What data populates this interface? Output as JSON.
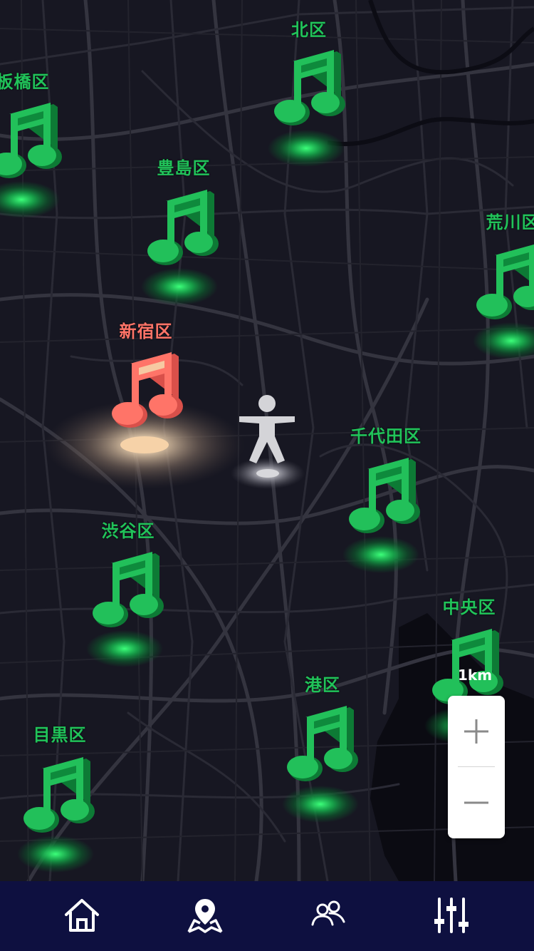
{
  "map": {
    "scale_label": "1km",
    "user_marker_icon": "person-icon",
    "districts": [
      {
        "id": "kita",
        "label": "北区",
        "icon": "music-note-icon",
        "color": "#21c35a",
        "active": false
      },
      {
        "id": "itabashi",
        "label": "板橋区",
        "icon": "music-note-icon",
        "color": "#21c35a",
        "active": false
      },
      {
        "id": "toshima",
        "label": "豊島区",
        "icon": "music-note-icon",
        "color": "#21c35a",
        "active": false
      },
      {
        "id": "arakawa",
        "label": "荒川区",
        "icon": "music-note-icon",
        "color": "#21c35a",
        "active": false
      },
      {
        "id": "shinjuku",
        "label": "新宿区",
        "icon": "music-note-icon",
        "color": "#ff7468",
        "active": true
      },
      {
        "id": "chiyoda",
        "label": "千代田区",
        "icon": "music-note-icon",
        "color": "#21c35a",
        "active": false
      },
      {
        "id": "shibuya",
        "label": "渋谷区",
        "icon": "music-note-icon",
        "color": "#21c35a",
        "active": false
      },
      {
        "id": "chuo",
        "label": "中央区",
        "icon": "music-note-icon",
        "color": "#21c35a",
        "active": false
      },
      {
        "id": "minato",
        "label": "港区",
        "icon": "music-note-icon",
        "color": "#21c35a",
        "active": false
      },
      {
        "id": "meguro",
        "label": "目黒区",
        "icon": "music-note-icon",
        "color": "#21c35a",
        "active": false
      }
    ]
  },
  "zoom": {
    "in_icon": "plus-icon",
    "out_icon": "minus-icon"
  },
  "tabbar": {
    "background": "#0e1040",
    "tabs": [
      {
        "name": "home",
        "icon": "home-icon"
      },
      {
        "name": "map",
        "icon": "map-pin-icon"
      },
      {
        "name": "people",
        "icon": "people-icon"
      },
      {
        "name": "settings",
        "icon": "sliders-icon"
      }
    ]
  }
}
